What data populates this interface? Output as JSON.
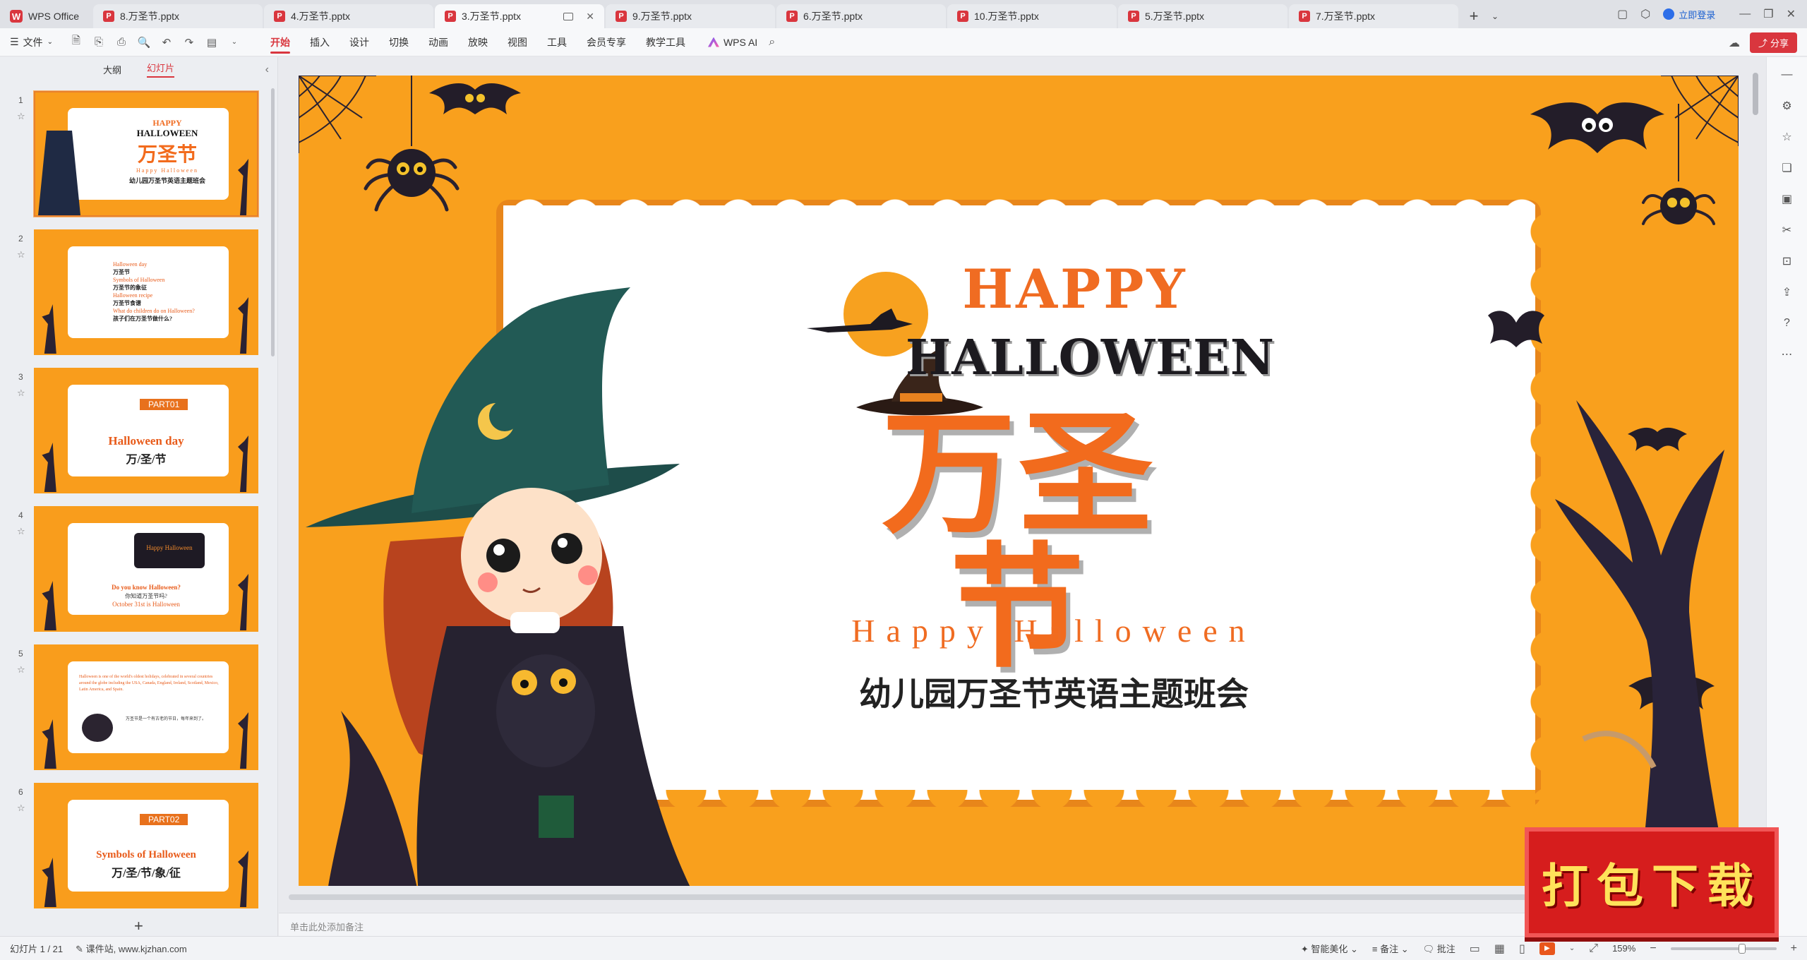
{
  "tabs": [
    {
      "label": "WPS Office",
      "type": "home"
    },
    {
      "label": "8.万圣节.pptx",
      "type": "doc"
    },
    {
      "label": "4.万圣节.pptx",
      "type": "doc"
    },
    {
      "label": "3.万圣节.pptx",
      "type": "doc",
      "active": true
    },
    {
      "label": "9.万圣节.pptx",
      "type": "doc"
    },
    {
      "label": "6.万圣节.pptx",
      "type": "doc"
    },
    {
      "label": "10.万圣节.pptx",
      "type": "doc"
    },
    {
      "label": "5.万圣节.pptx",
      "type": "doc"
    },
    {
      "label": "7.万圣节.pptx",
      "type": "doc"
    }
  ],
  "titlebar": {
    "login": "立即登录"
  },
  "ribbon": {
    "file": "文件",
    "menu": [
      "开始",
      "插入",
      "设计",
      "切换",
      "动画",
      "放映",
      "视图",
      "工具",
      "会员专享",
      "教学工具"
    ],
    "active_menu": "开始",
    "ai": "WPS AI",
    "share": "分享"
  },
  "left_panel": {
    "tabs": [
      "大纲",
      "幻灯片"
    ],
    "active_tab": "幻灯片",
    "slides": [
      {
        "num": "1",
        "title": "万圣节",
        "sub": "Happy Halloween",
        "caption": "幼儿园万圣节英语主题班会",
        "happy": "HAPPY",
        "halloween": "HALLOWEEN"
      },
      {
        "num": "2",
        "lines": [
          "Halloween day",
          "万圣节",
          "Symbols of Halloween",
          "万圣节的象征",
          "Halloween recipe",
          "万圣节食谱",
          "What do children do on Halloween?",
          "孩子们在万圣节做什么?"
        ]
      },
      {
        "num": "3",
        "part": "PART01",
        "title": "Halloween day",
        "sub": "万/圣/节"
      },
      {
        "num": "4",
        "title": "Do you know Halloween?",
        "sub": "你知道万圣节吗?",
        "date": "October 31st is Halloween",
        "sign": "Happy Halloween"
      },
      {
        "num": "5",
        "text": "Halloween is one of the world's oldest holidays, celebrated in several countries around the globe including the USA, Canada, England, Ireland, Scotland, Mexico, Latin America, and Spain.",
        "text_cn": "万圣节是一个有古老的节日，每年来到了。"
      },
      {
        "num": "6",
        "part": "PART02",
        "title": "Symbols of Halloween",
        "sub": "万/圣/节/象/征"
      }
    ]
  },
  "slide": {
    "happy": "HAPPY",
    "halloween": "HALLOWEEN",
    "title_cn": "万圣节",
    "subtitle_en": "Happy Halloween",
    "caption": "幼儿园万圣节英语主题班会"
  },
  "notes": {
    "placeholder": "单击此处添加备注"
  },
  "status": {
    "slide_info": "幻灯片 1 / 21",
    "theme": "课件站, www.kjzhan.com",
    "beautify": "智能美化",
    "notes": "备注",
    "comment": "批注",
    "zoom": "159%"
  },
  "badge": {
    "text": "打包下载"
  },
  "colors": {
    "accent": "#d9363e",
    "slide_bg": "#f9a01d",
    "title_orange": "#f26b1d"
  }
}
